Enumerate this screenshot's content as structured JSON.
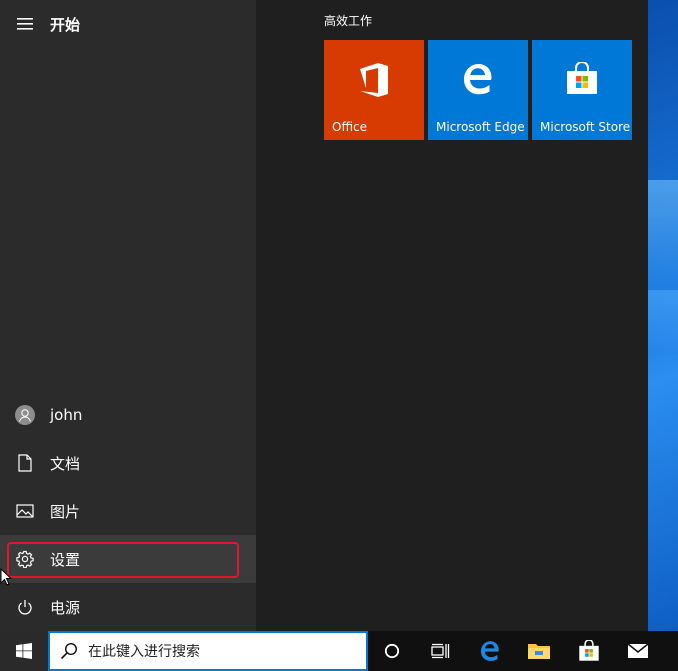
{
  "start_menu": {
    "header_label": "开始",
    "user_name": "john",
    "documents_label": "文档",
    "pictures_label": "图片",
    "settings_label": "设置",
    "power_label": "电源",
    "highlighted_item": "settings",
    "highlight_color": "#e3142c"
  },
  "tiles": {
    "group_title": "高效工作",
    "items": [
      {
        "label": "Office",
        "icon": "office-icon",
        "color": "#d83b01"
      },
      {
        "label": "Microsoft Edge",
        "icon": "edge-icon",
        "color": "#0078d7"
      },
      {
        "label": "Microsoft Store",
        "icon": "store-icon",
        "color": "#0078d7"
      }
    ]
  },
  "taskbar": {
    "search_placeholder": "在此键入进行搜索",
    "icons": [
      "windows-start-icon",
      "search-icon",
      "cortana-icon",
      "task-view-icon",
      "edge-icon",
      "file-explorer-icon",
      "store-icon",
      "mail-icon"
    ]
  }
}
